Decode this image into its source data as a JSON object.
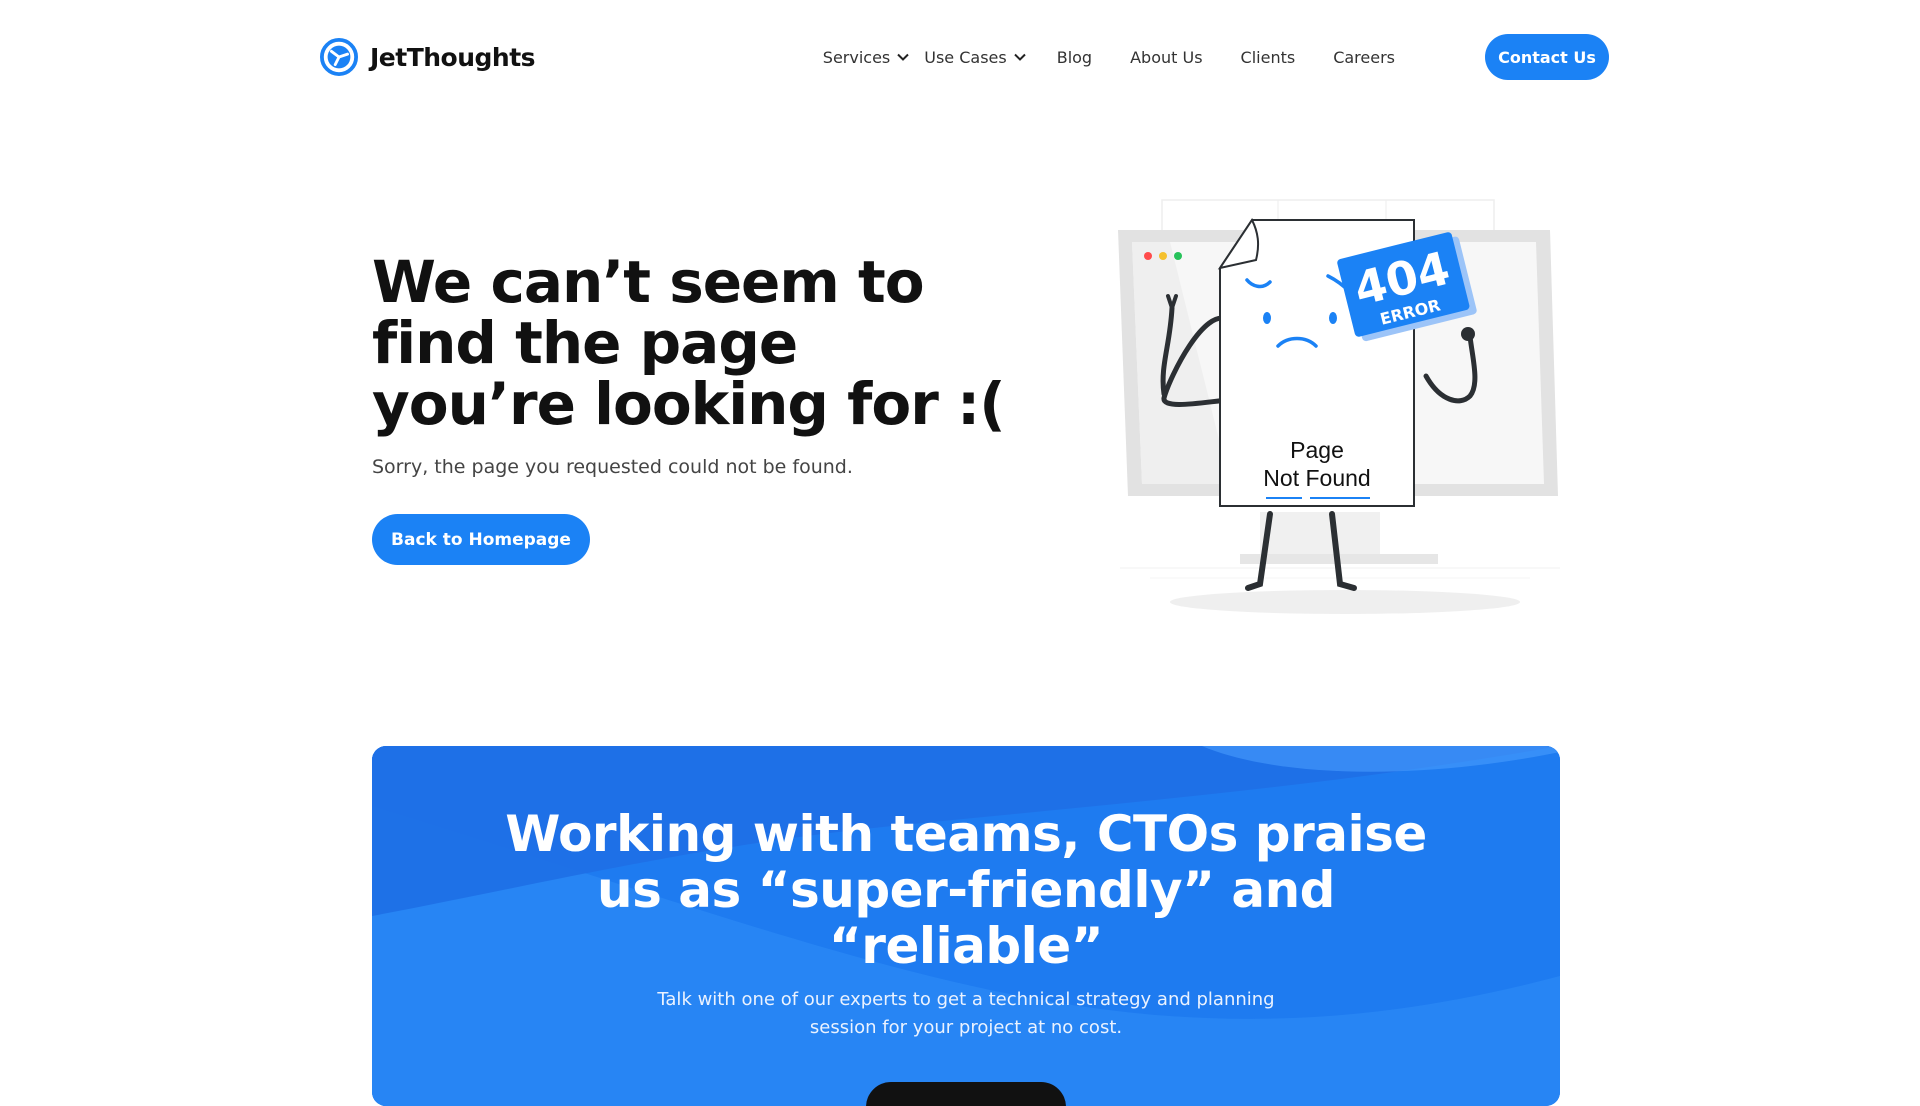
{
  "brand": {
    "name": "JetThoughts",
    "accent": "#1b82f5",
    "icon": "globe-logo-icon"
  },
  "nav": {
    "items": [
      {
        "label": "Services",
        "dropdown": true
      },
      {
        "label": "Use Cases",
        "dropdown": true
      },
      {
        "label": "Blog",
        "dropdown": false
      },
      {
        "label": "About Us",
        "dropdown": false
      },
      {
        "label": "Clients",
        "dropdown": false
      },
      {
        "label": "Careers",
        "dropdown": false
      }
    ],
    "contact_label": "Contact Us"
  },
  "hero": {
    "title_lines": [
      "We can’t seem to",
      "find the page",
      "you’re looking for :("
    ],
    "subtitle": "Sorry, the page you requested could not be found.",
    "button_label": "Back to Homepage"
  },
  "illustration": {
    "badge_number": "404",
    "badge_text": "ERROR",
    "page_line1": "Page",
    "page_line2": "Not Found"
  },
  "cta": {
    "title_lines": [
      "Working with teams, CTOs praise",
      "us as “super-friendly” and",
      "“reliable”"
    ],
    "subtitle_lines": [
      "Talk with one of our experts to get a technical strategy and planning",
      "session for your project at no cost."
    ],
    "bg_color": "#1e7bf0"
  }
}
